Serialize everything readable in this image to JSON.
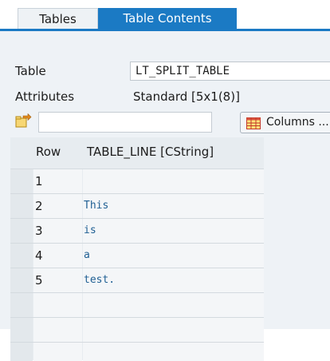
{
  "tabs": [
    {
      "label": "Tables",
      "active": false
    },
    {
      "label": "Table Contents",
      "active": true
    }
  ],
  "form": {
    "table_label": "Table",
    "table_value": "LT_SPLIT_TABLE",
    "attributes_label": "Attributes",
    "attributes_value": "Standard [5x1(8)]"
  },
  "toolbar": {
    "filter_value": "",
    "columns_label": "Columns ..."
  },
  "grid": {
    "headers": [
      "Row",
      "TABLE_LINE [CString]"
    ],
    "rows": [
      {
        "row": "1",
        "value": ""
      },
      {
        "row": "2",
        "value": "This"
      },
      {
        "row": "3",
        "value": "is"
      },
      {
        "row": "4",
        "value": "a"
      },
      {
        "row": "5",
        "value": "test."
      },
      {
        "row": "",
        "value": ""
      },
      {
        "row": "",
        "value": ""
      }
    ]
  },
  "colors": {
    "accent": "#1b7ac4",
    "panel_bg": "#eef2f6",
    "value_text": "#1f5f93"
  },
  "icons": {
    "toolbar": "details-folder-arrow-icon",
    "columns": "table-grid-icon"
  }
}
